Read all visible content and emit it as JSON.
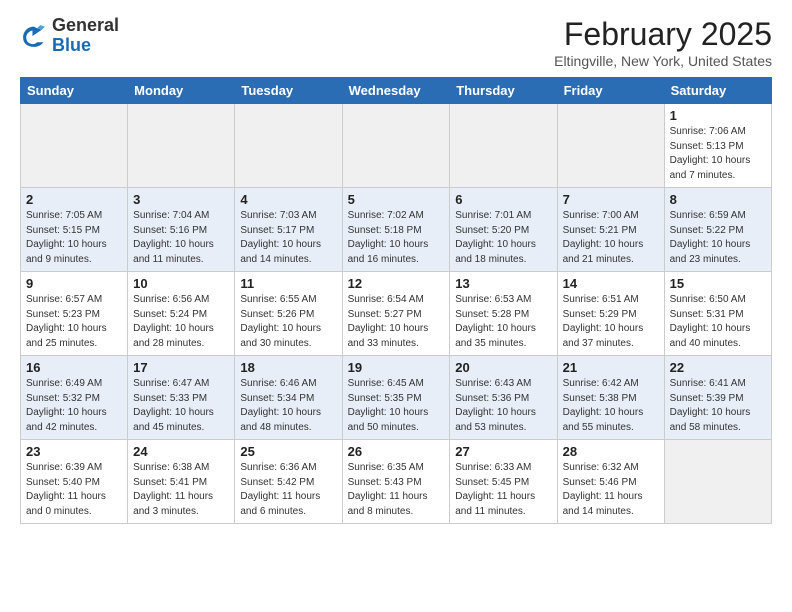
{
  "header": {
    "logo_general": "General",
    "logo_blue": "Blue",
    "month_title": "February 2025",
    "location": "Eltingville, New York, United States"
  },
  "weekdays": [
    "Sunday",
    "Monday",
    "Tuesday",
    "Wednesday",
    "Thursday",
    "Friday",
    "Saturday"
  ],
  "weeks": [
    [
      {
        "day": "",
        "info": ""
      },
      {
        "day": "",
        "info": ""
      },
      {
        "day": "",
        "info": ""
      },
      {
        "day": "",
        "info": ""
      },
      {
        "day": "",
        "info": ""
      },
      {
        "day": "",
        "info": ""
      },
      {
        "day": "1",
        "info": "Sunrise: 7:06 AM\nSunset: 5:13 PM\nDaylight: 10 hours and 7 minutes."
      }
    ],
    [
      {
        "day": "2",
        "info": "Sunrise: 7:05 AM\nSunset: 5:15 PM\nDaylight: 10 hours and 9 minutes."
      },
      {
        "day": "3",
        "info": "Sunrise: 7:04 AM\nSunset: 5:16 PM\nDaylight: 10 hours and 11 minutes."
      },
      {
        "day": "4",
        "info": "Sunrise: 7:03 AM\nSunset: 5:17 PM\nDaylight: 10 hours and 14 minutes."
      },
      {
        "day": "5",
        "info": "Sunrise: 7:02 AM\nSunset: 5:18 PM\nDaylight: 10 hours and 16 minutes."
      },
      {
        "day": "6",
        "info": "Sunrise: 7:01 AM\nSunset: 5:20 PM\nDaylight: 10 hours and 18 minutes."
      },
      {
        "day": "7",
        "info": "Sunrise: 7:00 AM\nSunset: 5:21 PM\nDaylight: 10 hours and 21 minutes."
      },
      {
        "day": "8",
        "info": "Sunrise: 6:59 AM\nSunset: 5:22 PM\nDaylight: 10 hours and 23 minutes."
      }
    ],
    [
      {
        "day": "9",
        "info": "Sunrise: 6:57 AM\nSunset: 5:23 PM\nDaylight: 10 hours and 25 minutes."
      },
      {
        "day": "10",
        "info": "Sunrise: 6:56 AM\nSunset: 5:24 PM\nDaylight: 10 hours and 28 minutes."
      },
      {
        "day": "11",
        "info": "Sunrise: 6:55 AM\nSunset: 5:26 PM\nDaylight: 10 hours and 30 minutes."
      },
      {
        "day": "12",
        "info": "Sunrise: 6:54 AM\nSunset: 5:27 PM\nDaylight: 10 hours and 33 minutes."
      },
      {
        "day": "13",
        "info": "Sunrise: 6:53 AM\nSunset: 5:28 PM\nDaylight: 10 hours and 35 minutes."
      },
      {
        "day": "14",
        "info": "Sunrise: 6:51 AM\nSunset: 5:29 PM\nDaylight: 10 hours and 37 minutes."
      },
      {
        "day": "15",
        "info": "Sunrise: 6:50 AM\nSunset: 5:31 PM\nDaylight: 10 hours and 40 minutes."
      }
    ],
    [
      {
        "day": "16",
        "info": "Sunrise: 6:49 AM\nSunset: 5:32 PM\nDaylight: 10 hours and 42 minutes."
      },
      {
        "day": "17",
        "info": "Sunrise: 6:47 AM\nSunset: 5:33 PM\nDaylight: 10 hours and 45 minutes."
      },
      {
        "day": "18",
        "info": "Sunrise: 6:46 AM\nSunset: 5:34 PM\nDaylight: 10 hours and 48 minutes."
      },
      {
        "day": "19",
        "info": "Sunrise: 6:45 AM\nSunset: 5:35 PM\nDaylight: 10 hours and 50 minutes."
      },
      {
        "day": "20",
        "info": "Sunrise: 6:43 AM\nSunset: 5:36 PM\nDaylight: 10 hours and 53 minutes."
      },
      {
        "day": "21",
        "info": "Sunrise: 6:42 AM\nSunset: 5:38 PM\nDaylight: 10 hours and 55 minutes."
      },
      {
        "day": "22",
        "info": "Sunrise: 6:41 AM\nSunset: 5:39 PM\nDaylight: 10 hours and 58 minutes."
      }
    ],
    [
      {
        "day": "23",
        "info": "Sunrise: 6:39 AM\nSunset: 5:40 PM\nDaylight: 11 hours and 0 minutes."
      },
      {
        "day": "24",
        "info": "Sunrise: 6:38 AM\nSunset: 5:41 PM\nDaylight: 11 hours and 3 minutes."
      },
      {
        "day": "25",
        "info": "Sunrise: 6:36 AM\nSunset: 5:42 PM\nDaylight: 11 hours and 6 minutes."
      },
      {
        "day": "26",
        "info": "Sunrise: 6:35 AM\nSunset: 5:43 PM\nDaylight: 11 hours and 8 minutes."
      },
      {
        "day": "27",
        "info": "Sunrise: 6:33 AM\nSunset: 5:45 PM\nDaylight: 11 hours and 11 minutes."
      },
      {
        "day": "28",
        "info": "Sunrise: 6:32 AM\nSunset: 5:46 PM\nDaylight: 11 hours and 14 minutes."
      },
      {
        "day": "",
        "info": ""
      }
    ]
  ]
}
